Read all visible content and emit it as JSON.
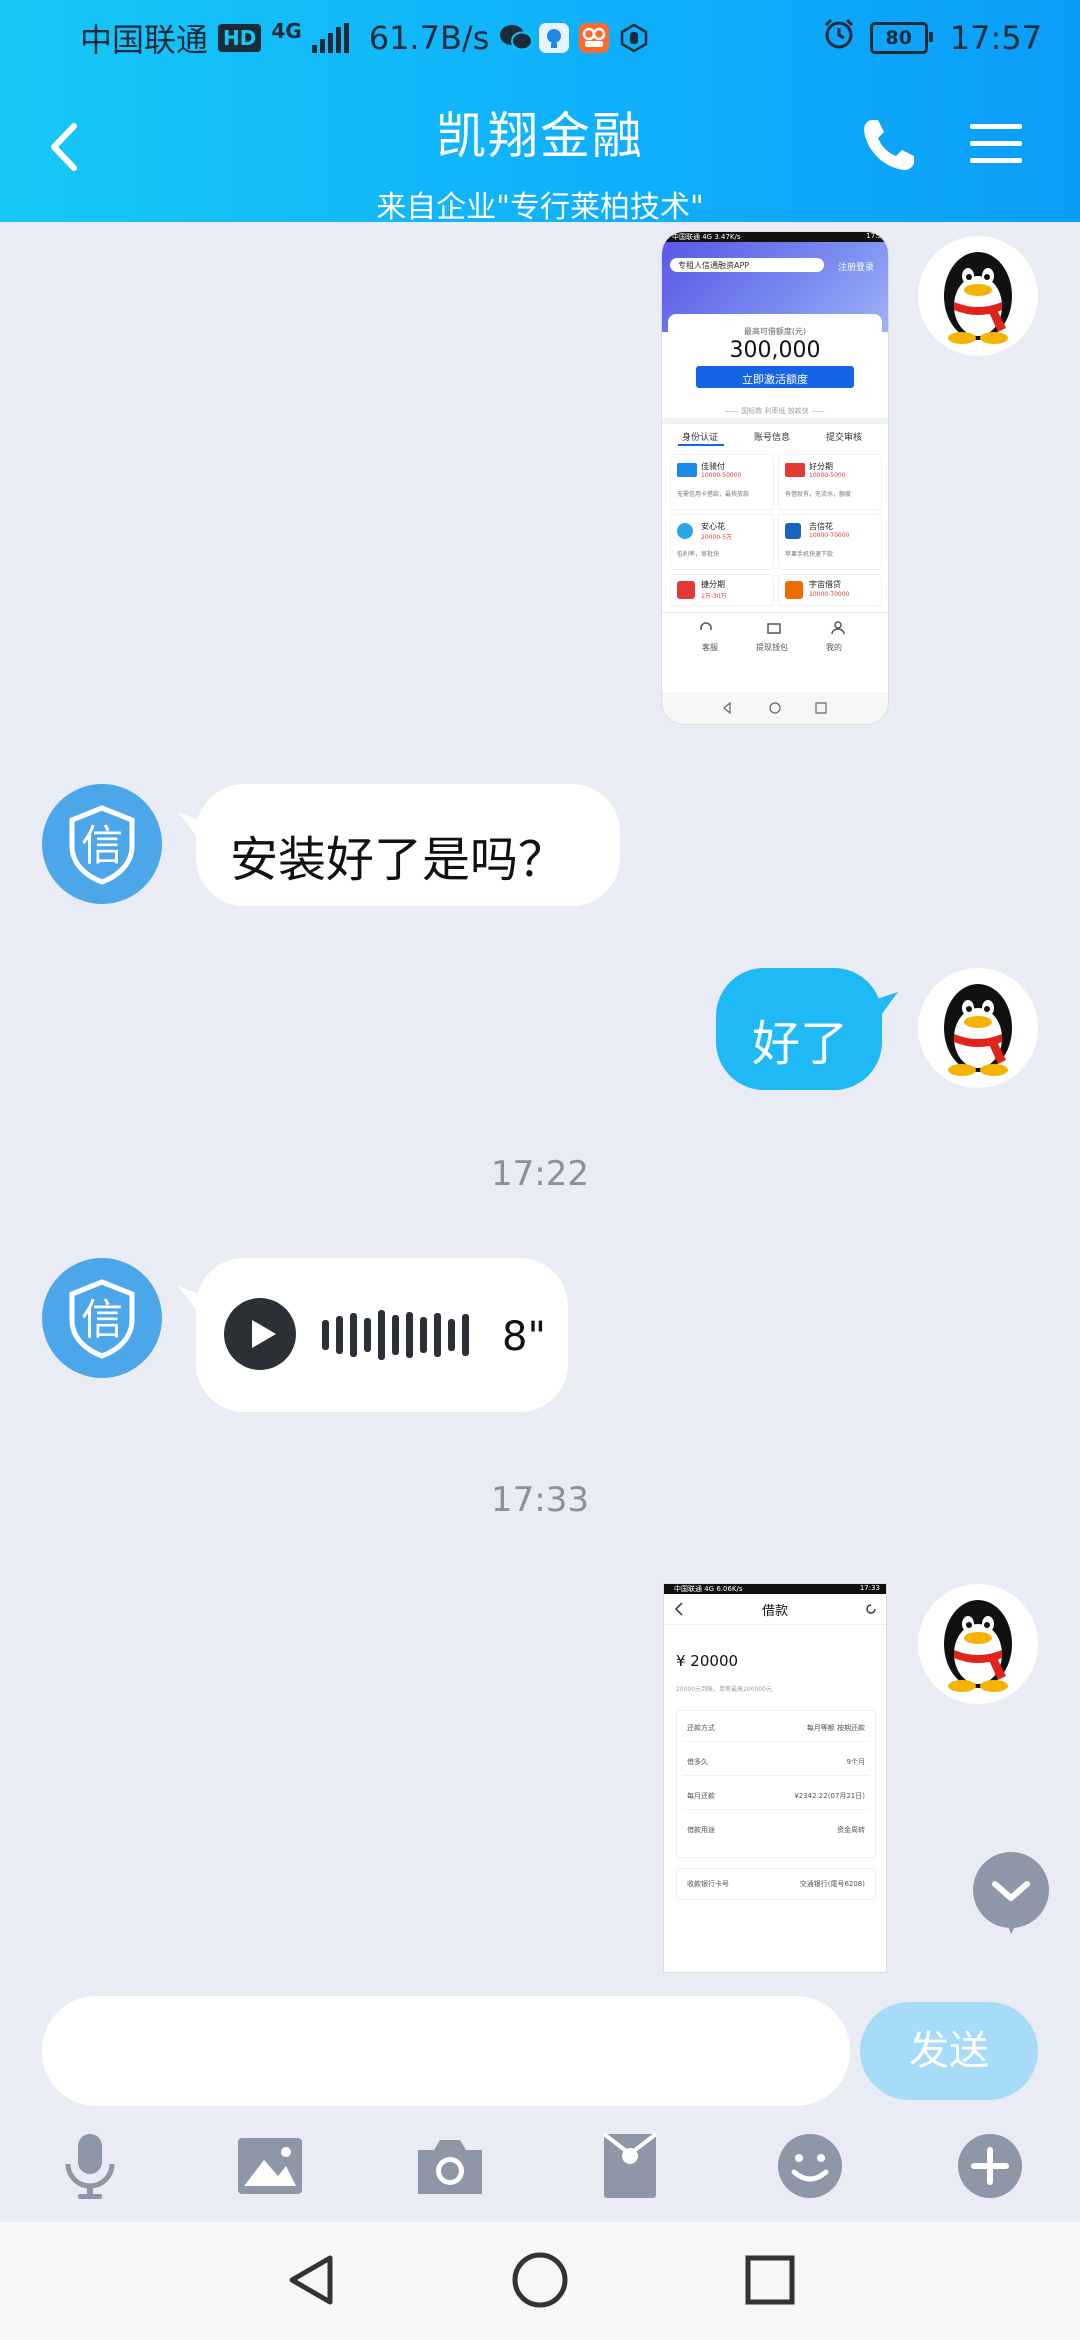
{
  "status_bar": {
    "carrier": "中国联通",
    "hd": "HD",
    "network": "4G",
    "speed": "61.7B/s",
    "battery": "80",
    "time": "17:57"
  },
  "header": {
    "title": "凯翔金融",
    "subtitle": "来自企业\"专行莱柏技术\""
  },
  "messages": {
    "m2_text": "安装好了是吗？",
    "m3_text": "好了",
    "ts1": "17:22",
    "voice_duration": "8\"",
    "ts2": "17:33"
  },
  "shot1": {
    "status_left": "中国联通 4G 3.47K/s",
    "status_time": "17:5",
    "search_placeholder": "专租人信通融资APP",
    "login_link": "注册登录",
    "limit_label": "最高可借额度(元)",
    "amount": "300,000",
    "activate_btn": "立即激活额度",
    "note": "—— 国标数 利率低 放款快 ——",
    "tab1": "身份认证",
    "tab2": "账号信息",
    "tab3": "提交审核",
    "p1_name": "佳骑付",
    "p1_range": "10000-50000",
    "p1_desc": "无需信用卡借款，最快放款",
    "p2_name": "好分期",
    "p2_range": "10000-5000",
    "p2_desc": "有借就有，无流水，额度",
    "p3_name": "安心花",
    "p3_range": "20000-5万",
    "p3_desc": "低利率，审批快",
    "p4_name": "吉信花",
    "p4_range": "10000-70000",
    "p4_desc": "苹果手机快速下款",
    "p5_name": "捷分期",
    "p5_range": "1万-30万",
    "p6_name": "宇宙借贷",
    "p6_range": "10000-70000",
    "nav1": "客服",
    "nav2": "提现钱包",
    "nav3": "我的"
  },
  "shot2": {
    "status_left": "中国联通 4G 6.06K/s",
    "status_time": "17:33",
    "title": "借款",
    "amount": "¥ 20000",
    "hint": "20000元到账，单笔最高200000元",
    "row1_label": "还款方式",
    "row1_value": "每月等额 按期还款",
    "row2_label": "借多久",
    "row2_value": "9个月",
    "row3_label": "每月还款",
    "row3_value": "¥2342.22(07月21日)",
    "row4_label": "借款用途",
    "row4_value": "资金周转",
    "row5_label": "收款银行卡号",
    "row5_value": "交通银行(尾号6208)"
  },
  "input": {
    "placeholder": "",
    "send_label": "发送"
  },
  "icons": {
    "toolbar": [
      "microphone-icon",
      "image-icon",
      "camera-icon",
      "red-packet-icon",
      "emoji-icon",
      "plus-icon"
    ],
    "nav": [
      "back-triangle-icon",
      "home-circle-icon",
      "recents-square-icon"
    ]
  },
  "colors": {
    "header_start": "#16c8f6",
    "header_end": "#0a9ef8",
    "sent_bubble": "#1fbaf6",
    "send_button": "#a7dcf8",
    "avatar_shield": "#4ca6ea",
    "background": "#e9ecf4"
  }
}
